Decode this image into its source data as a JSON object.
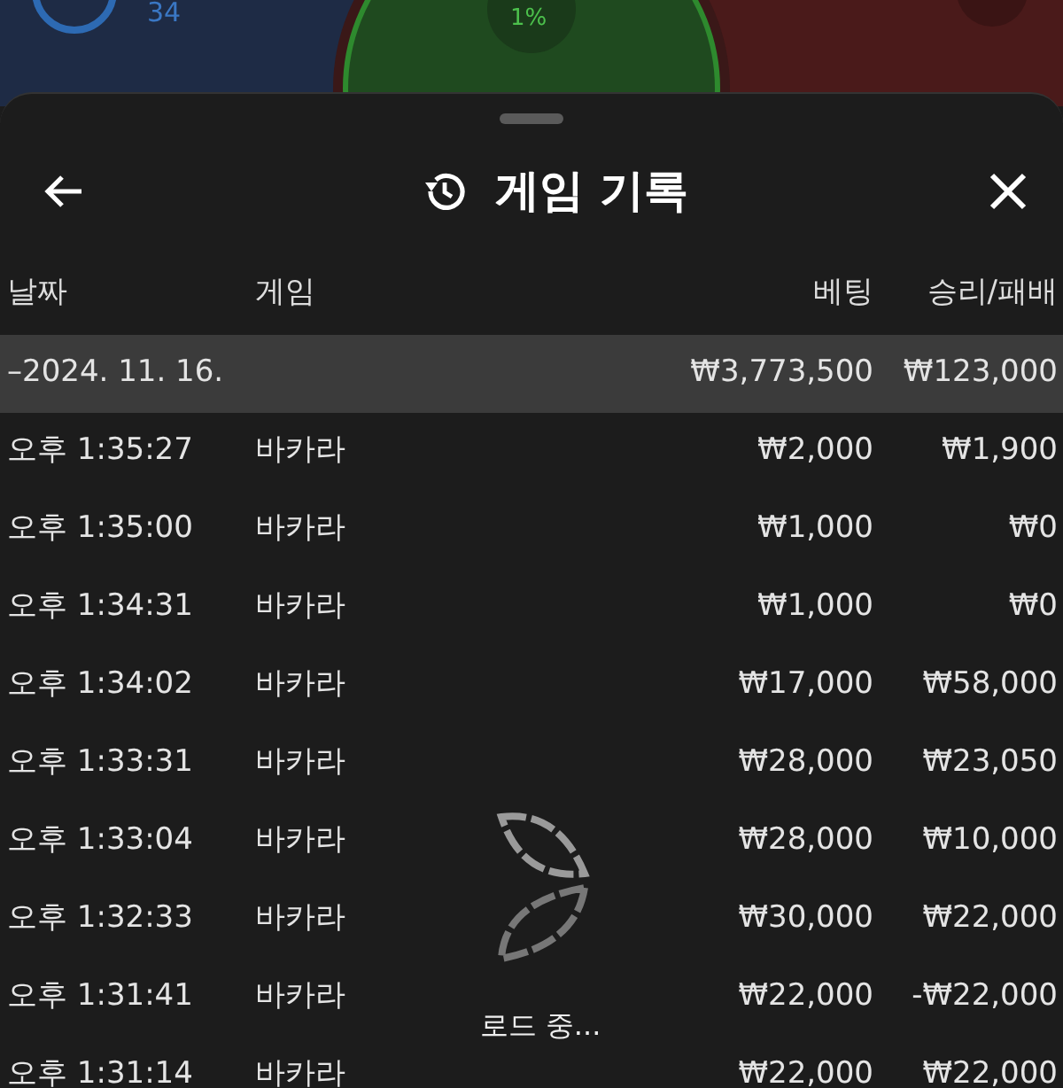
{
  "backdrop": {
    "player_count": "34",
    "percent": "1%"
  },
  "sheet": {
    "title": "게임 기록"
  },
  "table": {
    "columns": [
      "날짜",
      "게임",
      "베팅",
      "승리/패배"
    ],
    "group": {
      "date": "–2024. 11. 16.",
      "bet": "₩3,773,500",
      "result": "₩123,000"
    },
    "rows": [
      {
        "time": "오후 1:35:27",
        "game": "바카라",
        "bet": "₩2,000",
        "result": "₩1,900"
      },
      {
        "time": "오후 1:35:00",
        "game": "바카라",
        "bet": "₩1,000",
        "result": "₩0"
      },
      {
        "time": "오후 1:34:31",
        "game": "바카라",
        "bet": "₩1,000",
        "result": "₩0"
      },
      {
        "time": "오후 1:34:02",
        "game": "바카라",
        "bet": "₩17,000",
        "result": "₩58,000"
      },
      {
        "time": "오후 1:33:31",
        "game": "바카라",
        "bet": "₩28,000",
        "result": "₩23,050"
      },
      {
        "time": "오후 1:33:04",
        "game": "바카라",
        "bet": "₩28,000",
        "result": "₩10,000"
      },
      {
        "time": "오후 1:32:33",
        "game": "바카라",
        "bet": "₩30,000",
        "result": "₩22,000"
      },
      {
        "time": "오후 1:31:41",
        "game": "바카라",
        "bet": "₩22,000",
        "result": "-₩22,000"
      },
      {
        "time": "오후 1:31:14",
        "game": "바카라",
        "bet": "₩22,000",
        "result": "₩22,000"
      }
    ]
  },
  "loader": {
    "text": "로드 중..."
  }
}
